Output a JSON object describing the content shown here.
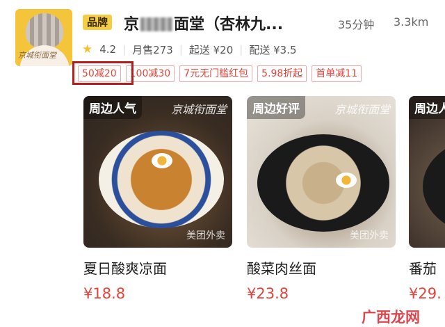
{
  "store": {
    "logo_text": "京城衔面堂",
    "brand_badge": "品牌",
    "name_left": "京",
    "name_right": "面堂（杏林九...",
    "eta": "35分钟",
    "distance": "3.3km",
    "rating": "4.2",
    "monthly_sales": "月售273",
    "min_order": "起送 ¥20",
    "delivery_fee": "配送 ¥3.5"
  },
  "promotions": [
    "50减20",
    "100减30",
    "7元无门槛红包",
    "5.98折起",
    "首单减11"
  ],
  "products": [
    {
      "tag": "周边人气",
      "watermark_top": "京城衔面堂",
      "watermark_bottom": "美团外卖",
      "name": "夏日酸爽凉面",
      "price": "¥18.8"
    },
    {
      "tag": "周边好评",
      "watermark_top": "京城衔面堂",
      "watermark_bottom": "美团外卖",
      "name": "酸菜肉丝面",
      "price": "¥23.8"
    },
    {
      "tag": "周边人",
      "name": "番茄",
      "price": "¥29."
    }
  ],
  "site_watermark": "广西龙网",
  "colors": {
    "brand_yellow": "#f5cd45",
    "price_red": "#e4433a",
    "promo_border": "#f0a7a7",
    "highlight_box": "#b51c1c"
  }
}
